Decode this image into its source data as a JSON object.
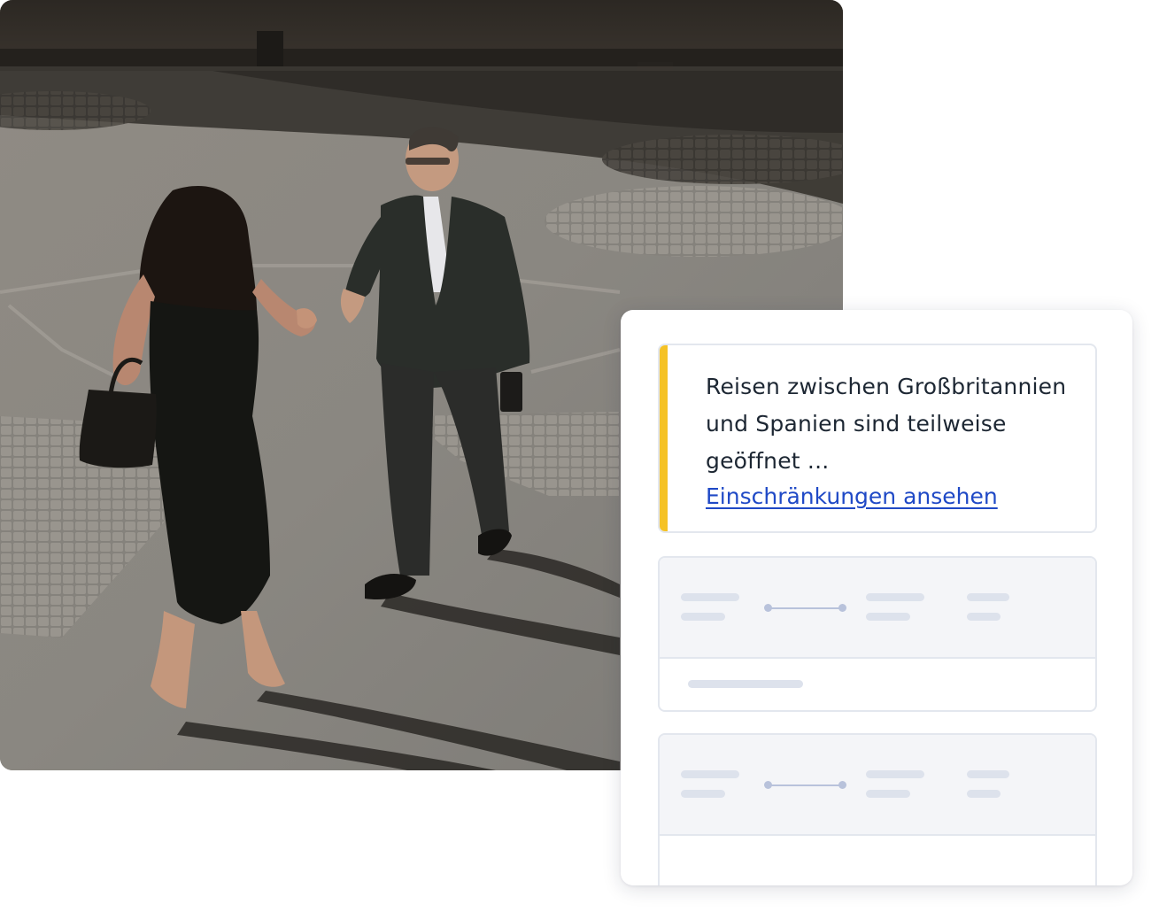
{
  "photo": {
    "subject": "business-handshake-photo"
  },
  "notice": {
    "message": "Reisen zwischen Großbritannien und Spanien sind teilweise geöffnet ...",
    "link_label": "Einschränkungen ansehen",
    "accent_color": "#f5c225",
    "link_color": "#1f49c6"
  },
  "placeholders": {
    "count": 2,
    "color": "#dde2ec"
  }
}
